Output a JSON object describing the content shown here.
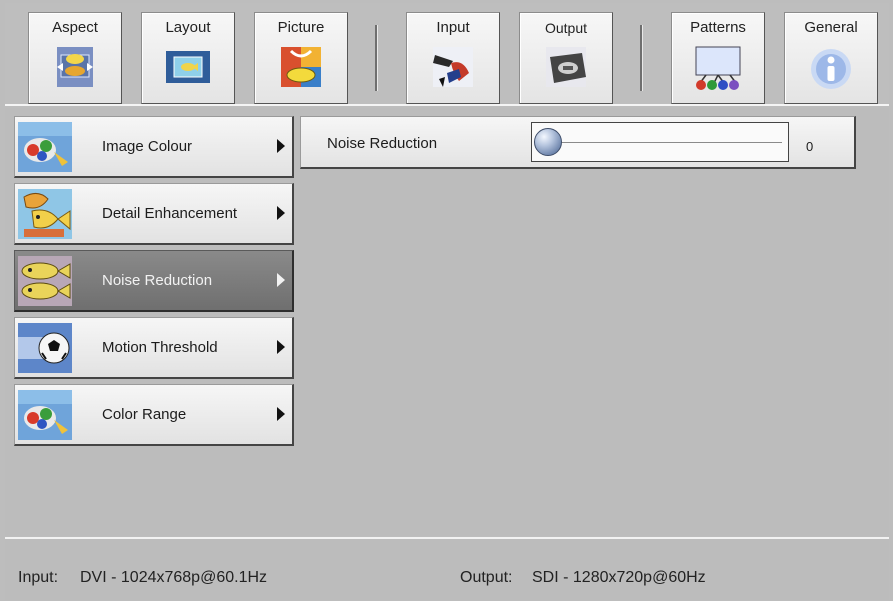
{
  "toolbar": {
    "buttons": [
      {
        "label": "Aspect",
        "icon": "aspect-icon"
      },
      {
        "label": "Layout",
        "icon": "layout-icon"
      },
      {
        "label": "Picture",
        "icon": "picture-icon"
      },
      {
        "label": "Input",
        "icon": "input-icon"
      },
      {
        "label": "Output",
        "icon": "output-icon"
      },
      {
        "label": "Patterns",
        "icon": "patterns-icon"
      },
      {
        "label": "General",
        "icon": "general-icon"
      }
    ]
  },
  "menu": {
    "items": [
      {
        "label": "Image Colour",
        "icon": "image-colour-icon"
      },
      {
        "label": "Detail Enhancement",
        "icon": "detail-enhancement-icon"
      },
      {
        "label": "Noise Reduction",
        "icon": "noise-reduction-icon"
      },
      {
        "label": "Motion Threshold",
        "icon": "motion-threshold-icon"
      },
      {
        "label": "Color Range",
        "icon": "color-range-icon"
      }
    ],
    "selected_index": 2
  },
  "setting": {
    "label": "Noise Reduction",
    "value": "0",
    "slider_fraction": 0.0
  },
  "status": {
    "input_label": "Input:",
    "input_value": "DVI - 1024x768p@60.1Hz",
    "output_label": "Output:",
    "output_value": "SDI - 1280x720p@60Hz"
  },
  "colors": {
    "background": "#bdbdbd",
    "selected_item": "#7d7d7d",
    "knob_accent": "#6f86ad"
  }
}
